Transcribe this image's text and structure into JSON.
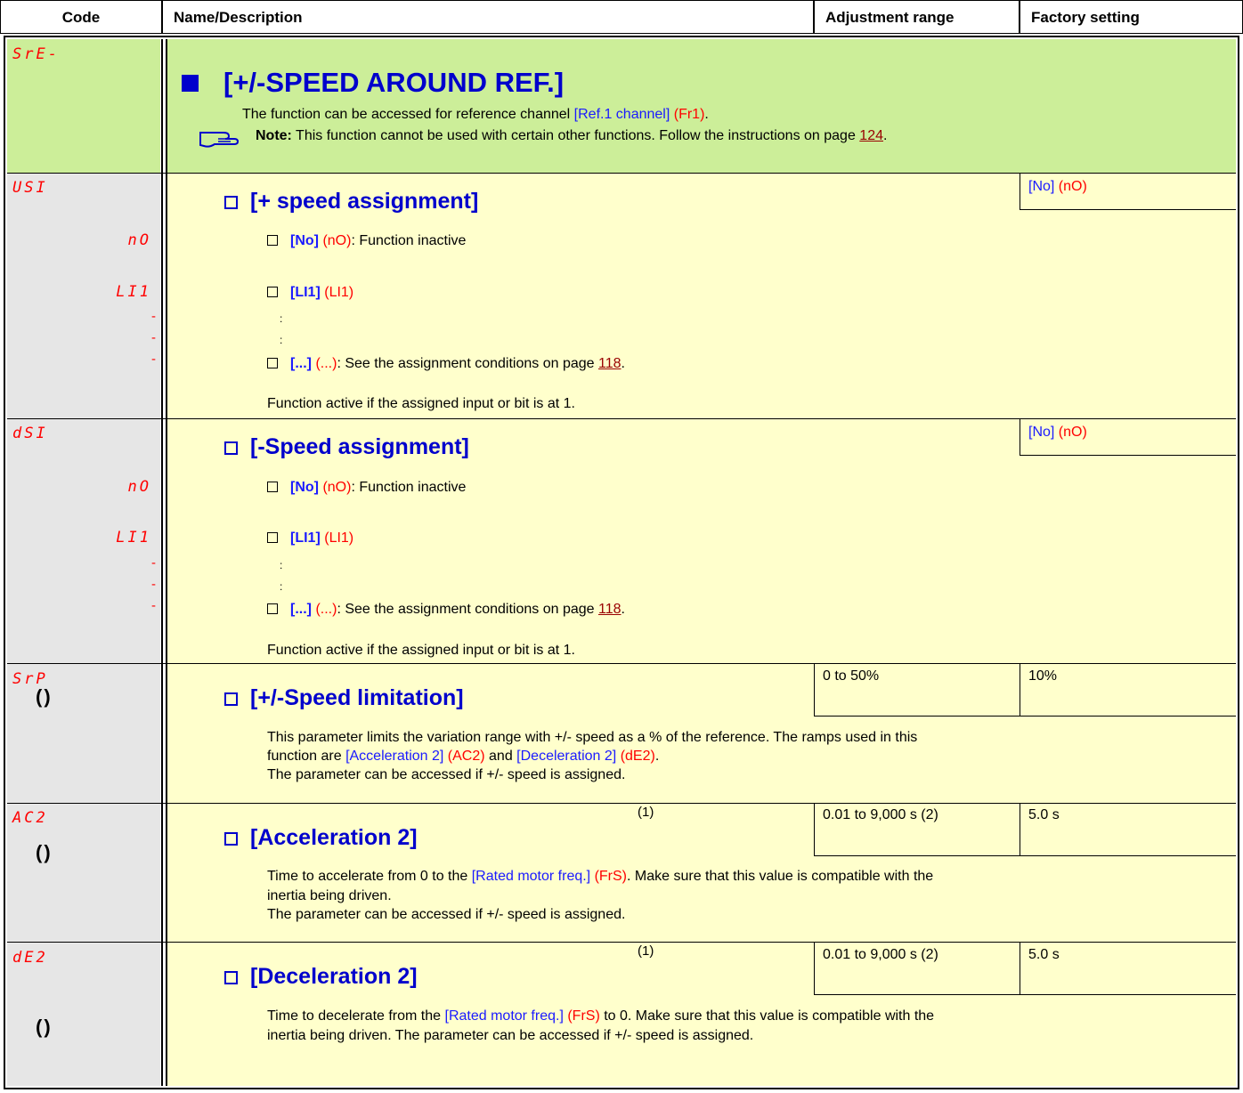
{
  "header": {
    "code": "Code",
    "name": "Name/Description",
    "range": "Adjustment range",
    "factory": "Factory setting"
  },
  "menu": {
    "code": "SrE-",
    "title": "[+/-SPEED AROUND REF.]",
    "desc_prefix": "The function can be accessed for reference channel ",
    "desc_param": "[Ref.1 channel]",
    "desc_code": "(Fr1)",
    "desc_suffix": ".",
    "note_label": "Note:",
    "note_text": " This function cannot be used with certain other functions. Follow the instructions on page ",
    "note_page": "124",
    "note_end": "."
  },
  "usi": {
    "code": "USI",
    "title": "[+ speed assignment]",
    "factory_name": "[No]",
    "factory_code": "(nO)",
    "opt1_code": "nO",
    "opt1_name": "[No]",
    "opt1_param": "(nO)",
    "opt1_text": ": Function inactive",
    "opt2_code": "LI1",
    "opt2_name": "[LI1]",
    "opt2_param": "(LI1)",
    "dash": "-",
    "dots": ":",
    "opt3_name": "[...]",
    "opt3_param": "(...)",
    "opt3_text": ": See the assignment conditions on page ",
    "opt3_page": "118",
    "opt3_end": ".",
    "footer": "Function active if the assigned input or bit is at 1."
  },
  "dsi": {
    "code": "dSI",
    "title": "[-Speed assignment]",
    "factory_name": "[No]",
    "factory_code": "(nO)",
    "opt1_code": "nO",
    "opt1_name": "[No]",
    "opt1_param": "(nO)",
    "opt1_text": ": Function inactive",
    "opt2_code": "LI1",
    "opt2_name": "[LI1]",
    "opt2_param": "(LI1)",
    "dash": "-",
    "dots": ":",
    "opt3_name": "[...]",
    "opt3_param": "(...)",
    "opt3_text": ": See the assignment conditions on page ",
    "opt3_page": "118",
    "opt3_end": ".",
    "footer": "Function active if the assigned input or bit is at 1."
  },
  "srp": {
    "code": "SrP",
    "title": "[+/-Speed limitation]",
    "range": "0 to 50%",
    "factory": "10%",
    "desc1": "This parameter limits the variation range with +/- speed as a % of the reference. The ramps used in this",
    "desc2_a": "function are ",
    "desc2_p1": "[Acceleration 2]",
    "desc2_c1": "(AC2)",
    "desc2_b": " and ",
    "desc2_p2": "[Deceleration 2]",
    "desc2_c2": "(dE2)",
    "desc2_end": ".",
    "desc3": "The parameter can be accessed if +/- speed is assigned."
  },
  "ac2": {
    "code": "AC2",
    "title": "[Acceleration 2]",
    "note": "(1)",
    "range": "0.01 to 9,000 s (2)",
    "factory": "5.0 s",
    "desc1_a": "Time to accelerate from 0 to the ",
    "desc1_p": "[Rated motor freq.]",
    "desc1_c": "(FrS)",
    "desc1_b": ". Make sure that this value is compatible with the",
    "desc2": "inertia being driven.",
    "desc3": "The parameter can be accessed if +/- speed is assigned."
  },
  "de2": {
    "code": "dE2",
    "title": "[Deceleration 2]",
    "note": "(1)",
    "range": "0.01 to 9,000 s (2)",
    "factory": "5.0 s",
    "desc1_a": "Time to decelerate from the ",
    "desc1_p": "[Rated motor freq.]",
    "desc1_c": "(FrS)",
    "desc1_b": " to 0. Make sure that this value is compatible with the",
    "desc2": "inertia being driven. The parameter can be accessed if +/- speed is assigned."
  },
  "rotate_symbol": "()",
  "icons": {
    "note": "pointing-hand-icon",
    "rotate": "change-while-running-icon"
  },
  "colors": {
    "blue": "#0000cc",
    "red": "#ff0000",
    "yellow": "#ffffcc",
    "green": "#ccee99",
    "grey": "#e6e6e6"
  }
}
